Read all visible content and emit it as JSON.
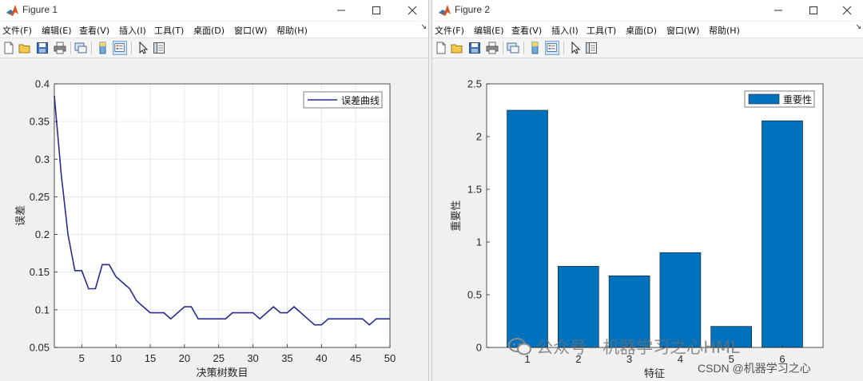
{
  "figure1": {
    "title": "Figure 1",
    "menus": [
      "文件(F)",
      "编辑(E)",
      "查看(V)",
      "插入(I)",
      "工具(T)",
      "桌面(D)",
      "窗口(W)",
      "帮助(H)"
    ],
    "chart_data": {
      "type": "line",
      "xlabel": "决策树数目",
      "ylabel": "误差",
      "xlim": [
        1,
        50
      ],
      "ylim": [
        0.05,
        0.4
      ],
      "xticks": [
        5,
        10,
        15,
        20,
        25,
        30,
        35,
        40,
        45,
        50
      ],
      "yticks": [
        0.05,
        0.1,
        0.15,
        0.2,
        0.25,
        0.3,
        0.35,
        0.4
      ],
      "ytick_labels": [
        "0.05",
        "0.1",
        "0.15",
        "0.2",
        "0.25",
        "0.3",
        "0.35",
        "0.4"
      ],
      "grid": true,
      "legend_position": "top-right",
      "line_color": "#2a2a8f",
      "series": [
        {
          "name": "误差曲线",
          "x": [
            1,
            2,
            3,
            4,
            5,
            6,
            7,
            8,
            9,
            10,
            11,
            12,
            13,
            14,
            15,
            16,
            17,
            18,
            19,
            20,
            21,
            22,
            23,
            24,
            25,
            26,
            27,
            28,
            29,
            30,
            31,
            32,
            33,
            34,
            35,
            36,
            37,
            38,
            39,
            40,
            41,
            42,
            43,
            44,
            45,
            46,
            47,
            48,
            49,
            50
          ],
          "y": [
            0.384,
            0.28,
            0.2,
            0.152,
            0.152,
            0.128,
            0.128,
            0.16,
            0.16,
            0.144,
            0.136,
            0.128,
            0.112,
            0.104,
            0.096,
            0.096,
            0.096,
            0.088,
            0.096,
            0.104,
            0.104,
            0.088,
            0.088,
            0.088,
            0.088,
            0.088,
            0.096,
            0.096,
            0.096,
            0.096,
            0.088,
            0.096,
            0.104,
            0.096,
            0.096,
            0.104,
            0.096,
            0.088,
            0.08,
            0.08,
            0.088,
            0.088,
            0.088,
            0.088,
            0.088,
            0.088,
            0.08,
            0.088,
            0.088,
            0.088
          ]
        }
      ]
    }
  },
  "figure2": {
    "title": "Figure 2",
    "menus": [
      "文件(F)",
      "编辑(E)",
      "查看(V)",
      "插入(I)",
      "工具(T)",
      "桌面(D)",
      "窗口(W)",
      "帮助(H)"
    ],
    "chart_data": {
      "type": "bar",
      "xlabel": "特征",
      "ylabel": "重要性",
      "categories": [
        "1",
        "2",
        "3",
        "4",
        "5",
        "6"
      ],
      "ylim": [
        0,
        2.5
      ],
      "yticks": [
        0,
        0.5,
        1,
        1.5,
        2,
        2.5
      ],
      "ytick_labels": [
        "0",
        "0.5",
        "1",
        "1.5",
        "2",
        "2.5"
      ],
      "legend_position": "top-right",
      "bar_color": "#0072bd",
      "series": [
        {
          "name": "重要性",
          "values": [
            2.25,
            0.77,
            0.68,
            0.9,
            0.2,
            2.15
          ]
        }
      ]
    }
  },
  "watermark": {
    "wechat": "公众号 · 机器学习之心HML",
    "csdn": "CSDN @机器学习之心"
  }
}
